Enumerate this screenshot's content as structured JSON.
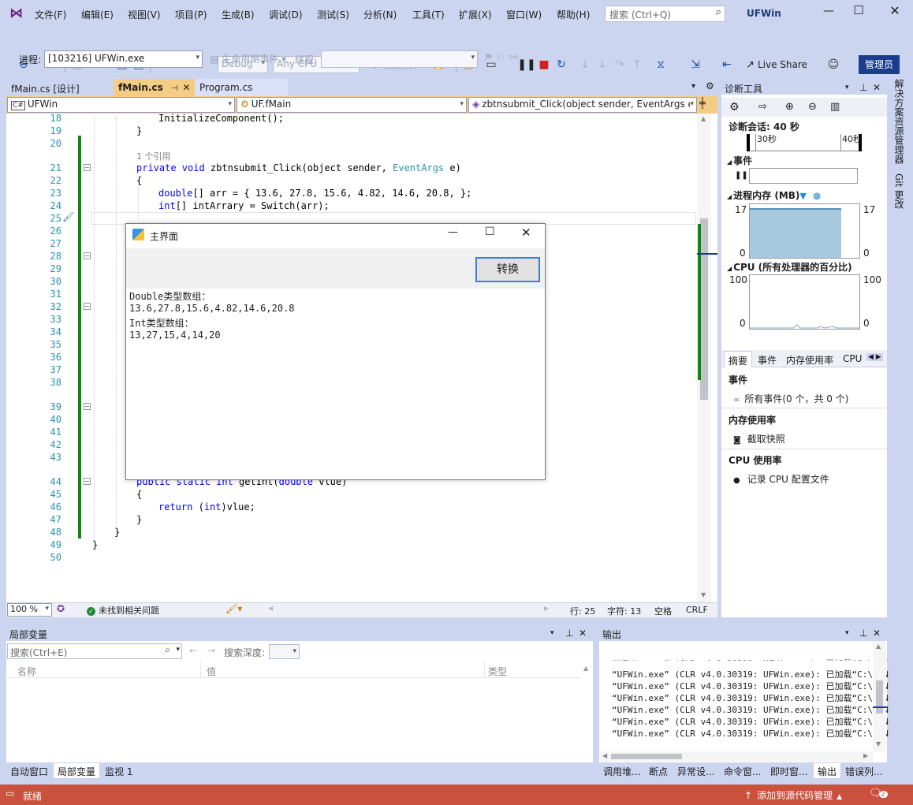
{
  "menu": {
    "items": [
      "文件(F)",
      "编辑(E)",
      "视图(V)",
      "项目(P)",
      "生成(B)",
      "调试(D)",
      "测试(S)",
      "分析(N)",
      "工具(T)",
      "扩展(X)",
      "窗口(W)",
      "帮助(H)"
    ],
    "search_placeholder": "搜索 (Ctrl+Q)",
    "app_title": "UFWin",
    "admin": "管理员"
  },
  "toolbar": {
    "config": "Debug",
    "platform": "Any CPU",
    "continue": "继续(C)",
    "live_share": "Live Share"
  },
  "debugbar": {
    "process_label": "进程:",
    "process_value": "[103216] UFWin.exe",
    "lifecycle": "生命周期事件",
    "thread_label": "线程:"
  },
  "tabs": {
    "t1": "fMain.cs [设计]",
    "t2": "fMain.cs",
    "t3": "Program.cs"
  },
  "nav": {
    "project": "UFWin",
    "klass": "UF.fMain",
    "member": "zbtnsubmit_Click(object sender, EventArgs e"
  },
  "editor": {
    "lines": [
      "18",
      "19",
      "20",
      "21",
      "22",
      "23",
      "24",
      "25",
      "26",
      "27",
      "28",
      "29",
      "30",
      "31",
      "32",
      "33",
      "34",
      "35",
      "36",
      "37",
      "38",
      "39",
      "40",
      "41",
      "42",
      "43",
      "44",
      "45",
      "46",
      "47",
      "48",
      "49",
      "50"
    ],
    "code": {
      "l18": "InitializeComponent();",
      "l19": "}",
      "ref": "1 个引用",
      "l21a": "private void",
      "l21b": " zbtnsubmit_Click(object sender, ",
      "l21c": "EventArgs",
      "l21d": " e)",
      "l22": "{",
      "l23a": "double",
      "l23b": "[] arr = { 13.6, 27.8, 15.6, 4.82, 14.6, 20.8, };",
      "l24a": "int",
      "l24b": "[] intArrary = Switch(arr);",
      "l44a": "public static int",
      "l44b": " getInt(",
      "l44c": "double",
      "l44d": " vlue)",
      "l45": "{",
      "l46a": "return",
      "l46b": " (",
      "l46c": "int",
      "l46d": ")vlue;",
      "l47": "}",
      "l48": "}",
      "l49": "}"
    }
  },
  "dialog": {
    "title": "主界面",
    "button": "转换",
    "text1": "Double类型数组：",
    "text2": "13.6,27.8,15.6,4.82,14.6,20.8",
    "text3": "Int类型数组：",
    "text4": "13,27,15,4,14,20"
  },
  "editorstatus": {
    "zoom": "100 %",
    "issues": "未找到相关问题",
    "row": "行: 25",
    "col": "字符: 13",
    "space": "空格",
    "crlf": "CRLF"
  },
  "diag": {
    "title": "诊断工具",
    "session": "诊断会话: 40 秒",
    "t30": "30秒",
    "t40": "40秒",
    "events": "事件",
    "mem": "进程内存 (MB)",
    "mem_max": "17",
    "mem_min": "0",
    "cpu": "CPU (所有处理器的百分比)",
    "cpu_max": "100",
    "cpu_min": "0",
    "tabs": [
      "摘要",
      "事件",
      "内存使用率",
      "CPU"
    ],
    "sec_events": "事件",
    "all_events": "所有事件(0 个，共 0 个)",
    "sec_mem": "内存使用率",
    "snapshot": "截取快照",
    "sec_cpu": "CPU 使用率",
    "cpu_profile": "记录 CPU 配置文件"
  },
  "side": {
    "a": "解决方案资源管理器",
    "b": "Git 更改"
  },
  "locals": {
    "title": "局部变量",
    "search": "搜索(Ctrl+E)",
    "depth": "搜索深度:",
    "col_name": "名称",
    "col_value": "值",
    "col_type": "类型"
  },
  "output": {
    "title": "输出",
    "lines": [
      "“UFWin.exe” (CLR v4.0.30319: UFWin.exe): 已加载“C:\\WIN",
      "“UFWin.exe” (CLR v4.0.30319: UFWin.exe): 已加载“C:\\WIN",
      "“UFWin.exe” (CLR v4.0.30319: UFWin.exe): 已加载“C:\\WIN",
      "“UFWin.exe” (CLR v4.0.30319: UFWin.exe): 已加载“C:\\WIN",
      "“UFWin.exe” (CLR v4.0.30319: UFWin.exe): 已加载“C:\\WIN",
      "“UFWin.exe” (CLR v4.0.30319: UFWin.exe): 已加载“C:\\WIN",
      "“UFWin.exe” (CLR v4.0.30319: UFWin.exe): 已加载“C:\\WIN"
    ]
  },
  "bottomtabs": {
    "left": [
      "自动窗口",
      "局部变量",
      "监视 1"
    ],
    "right": [
      "调用堆...",
      "断点",
      "异常设...",
      "命令窗...",
      "即时窗...",
      "输出",
      "错误列..."
    ]
  },
  "statusbar": {
    "ready": "就绪",
    "source": "添加到源代码管理",
    "badge": "2"
  }
}
